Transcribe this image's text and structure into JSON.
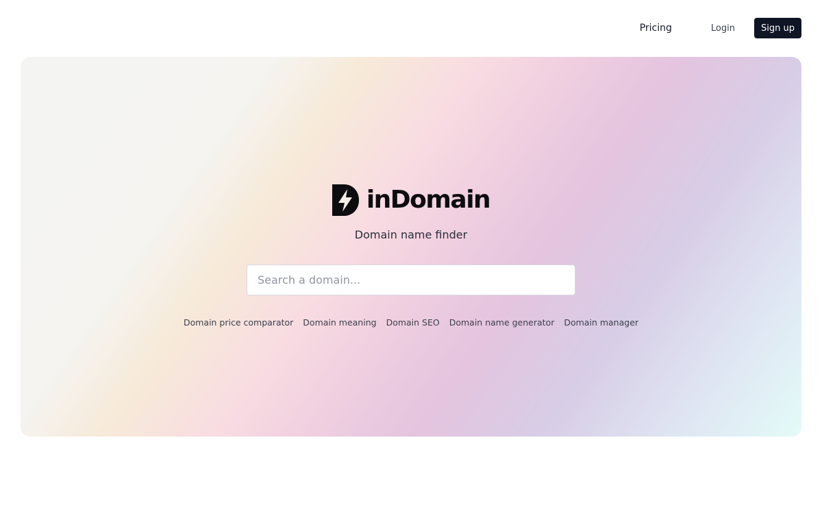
{
  "nav": {
    "pricing": "Pricing",
    "login": "Login",
    "signup": "Sign up"
  },
  "brand": {
    "name": "inDomain",
    "logo_icon": "lightning-d-logo"
  },
  "tagline": "Domain name finder",
  "search": {
    "placeholder": "Search a domain...",
    "value": ""
  },
  "links": [
    "Domain price comparator",
    "Domain meaning",
    "Domain SEO",
    "Domain name generator",
    "Domain manager"
  ],
  "colors": {
    "signup_bg": "#0f1525",
    "brand_text": "#0d0d10"
  }
}
